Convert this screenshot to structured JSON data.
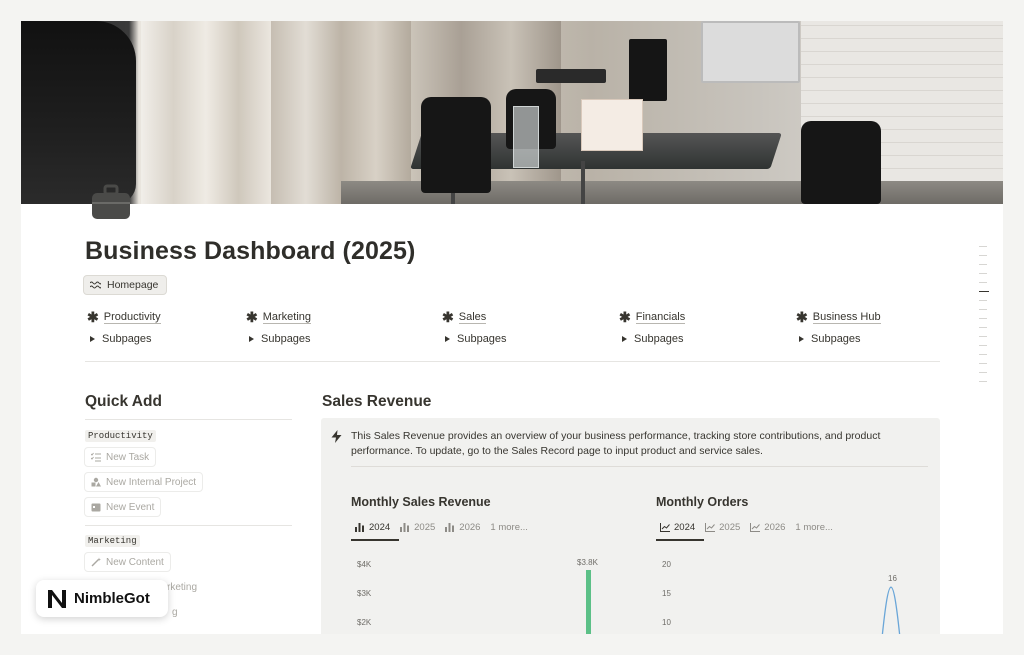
{
  "page": {
    "title": "Business Dashboard (2025)",
    "home_chip": "Homepage"
  },
  "nav": [
    {
      "label": "Productivity",
      "sub": "Subpages"
    },
    {
      "label": "Marketing",
      "sub": "Subpages"
    },
    {
      "label": "Sales",
      "sub": "Subpages"
    },
    {
      "label": "Financials",
      "sub": "Subpages"
    },
    {
      "label": "Business Hub",
      "sub": "Subpages"
    }
  ],
  "quick_add": {
    "heading": "Quick Add",
    "productivity_tag": "Productivity",
    "productivity_items": [
      "New Task",
      "New Internal Project",
      "New Event"
    ],
    "marketing_tag": "Marketing",
    "marketing_items": [
      "New Content",
      "rketing",
      "g"
    ]
  },
  "sales": {
    "heading": "Sales Revenue",
    "callout": "This Sales Revenue provides an overview of your business performance, tracking store contributions, and product performance. To update, go to the Sales Record page to input product and service sales.",
    "revenue_title": "Monthly Sales Revenue",
    "revenue_tabs": [
      "2024",
      "2025",
      "2026",
      "1 more..."
    ],
    "orders_title": "Monthly Orders",
    "orders_tabs": [
      "2024",
      "2025",
      "2026",
      "1 more..."
    ]
  },
  "chart_data": [
    {
      "type": "bar",
      "title": "Monthly Sales Revenue",
      "y_ticks": [
        "$4K",
        "$3K",
        "$2K"
      ],
      "y_ticks_values": [
        4000,
        3000,
        2000
      ],
      "series": [
        {
          "values": [
            3800
          ],
          "labels": [
            "$3.8K"
          ]
        }
      ],
      "color": "#5cc087"
    },
    {
      "type": "line",
      "title": "Monthly Orders",
      "y_ticks": [
        "20",
        "15",
        "10"
      ],
      "y_ticks_values": [
        20,
        15,
        10
      ],
      "series": [
        {
          "values": [
            16
          ],
          "labels": [
            "16"
          ]
        }
      ],
      "color": "#6aa6d8"
    }
  ],
  "brand": {
    "name": "NimbleGot"
  },
  "colors": {
    "accent_green": "#5cc087",
    "accent_blue": "#6aa6d8",
    "text": "#37352f"
  }
}
